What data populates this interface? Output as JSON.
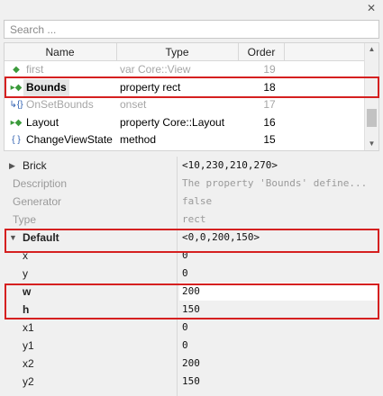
{
  "window": {
    "close_glyph": "✕"
  },
  "search": {
    "placeholder": "Search ..."
  },
  "members": {
    "columns": {
      "name": "Name",
      "type": "Type",
      "order": "Order"
    },
    "rows": [
      {
        "icon": "member-icon",
        "name": "first",
        "type": "var Core::View",
        "order": "19"
      },
      {
        "icon": "property-icon",
        "name": "Bounds",
        "type": "property rect",
        "order": "18"
      },
      {
        "icon": "onset-icon",
        "name": "OnSetBounds",
        "type": "onset",
        "order": "17"
      },
      {
        "icon": "property-icon",
        "name": "Layout",
        "type": "property Core::Layout",
        "order": "16"
      },
      {
        "icon": "method-icon",
        "name": "ChangeViewState",
        "type": "method",
        "order": "15"
      }
    ]
  },
  "properties": {
    "brick": {
      "name": "Brick",
      "value": "<10,230,210,270>"
    },
    "description": {
      "name": "Description",
      "value": "The property 'Bounds' define..."
    },
    "generator": {
      "name": "Generator",
      "value": "false"
    },
    "type": {
      "name": "Type",
      "value": "rect"
    },
    "default": {
      "name": "Default",
      "value": "<0,0,200,150>"
    },
    "x": {
      "name": "x",
      "value": "0"
    },
    "y": {
      "name": "y",
      "value": "0"
    },
    "w": {
      "name": "w",
      "value": "200"
    },
    "h": {
      "name": "h",
      "value": "150"
    },
    "x1": {
      "name": "x1",
      "value": "0"
    },
    "y1": {
      "name": "y1",
      "value": "0"
    },
    "x2": {
      "name": "x2",
      "value": "200"
    },
    "y2": {
      "name": "y2",
      "value": "150"
    }
  },
  "colors": {
    "highlight": "#d52020",
    "property_icon": "#3b9a3b",
    "method_icon": "#2e5fb0"
  }
}
